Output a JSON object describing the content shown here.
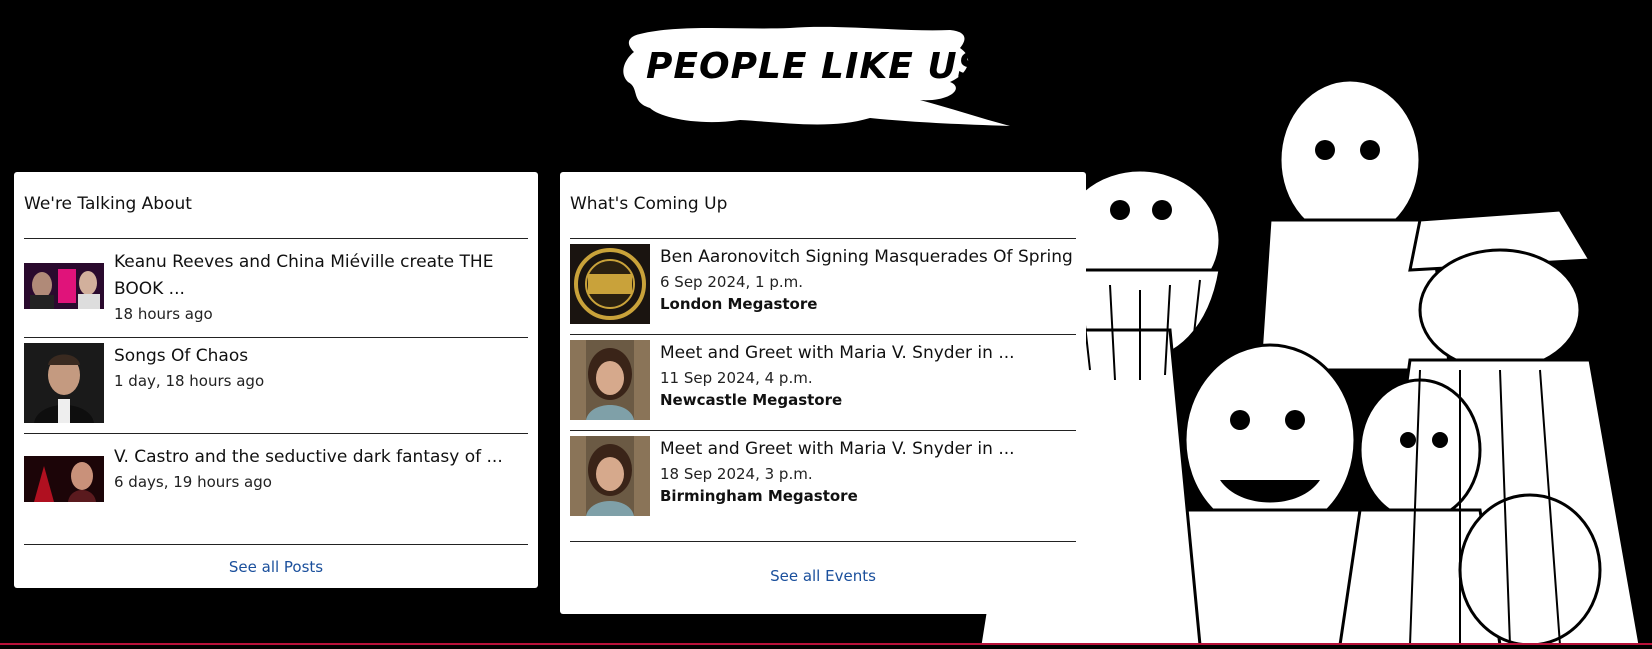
{
  "heading": "PEOPLE LIKE US...",
  "posts_card": {
    "title": "We're Talking About",
    "items": [
      {
        "title": "Keanu Reeves and China Miéville create THE BOOK ...",
        "time": "18 hours ago"
      },
      {
        "title": "Songs Of Chaos",
        "time": "1 day, 18 hours ago"
      },
      {
        "title": "V. Castro and the seductive dark fantasy of ...",
        "time": "6 days, 19 hours ago"
      }
    ],
    "see_all": "See all Posts"
  },
  "events_card": {
    "title": "What's Coming Up",
    "items": [
      {
        "title": "Ben Aaronovitch Signing Masquerades Of Spring",
        "date": "6 Sep 2024, 1 p.m.",
        "venue": "London Megastore"
      },
      {
        "title": "Meet and Greet with Maria V. Snyder in ...",
        "date": "11 Sep 2024, 4 p.m.",
        "venue": "Newcastle Megastore"
      },
      {
        "title": "Meet and Greet with Maria V. Snyder in ...",
        "date": "18 Sep 2024, 3 p.m.",
        "venue": "Birmingham Megastore"
      }
    ],
    "see_all": "See all Events"
  },
  "colors": {
    "link": "#1a4f9c",
    "background": "#000000",
    "card": "#ffffff",
    "accent_line": "#b8123a"
  }
}
